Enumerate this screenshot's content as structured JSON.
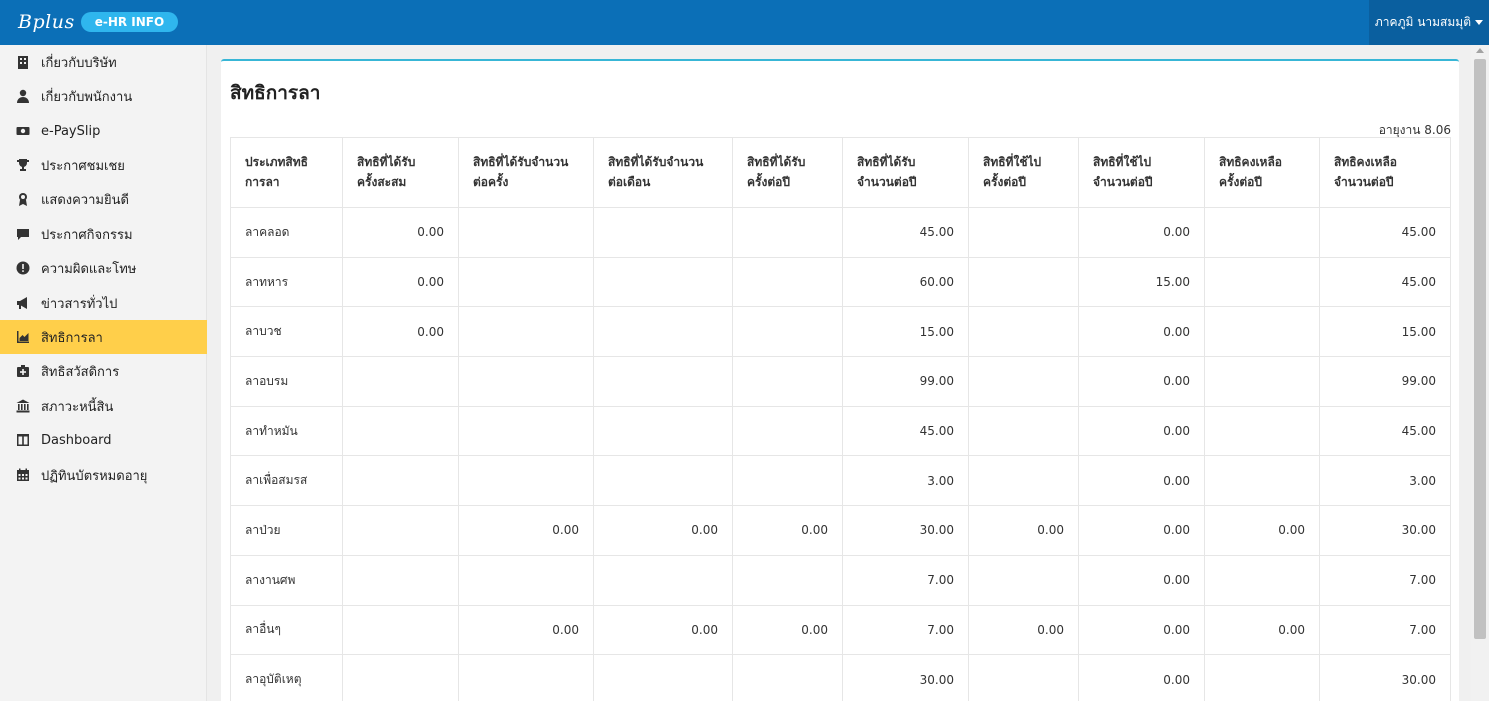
{
  "header": {
    "logo_text": "Bplus",
    "app_badge": "e-HR INFO",
    "user_name": "ภาคภูมิ นามสมมุติ"
  },
  "sidebar": {
    "items": [
      {
        "label": "เกี่ยวกับบริษัท",
        "icon": "building-icon",
        "active": false
      },
      {
        "label": "เกี่ยวกับพนักงาน",
        "icon": "user-icon",
        "active": false
      },
      {
        "label": "e-PaySlip",
        "icon": "money-icon",
        "active": false
      },
      {
        "label": "ประกาศชมเชย",
        "icon": "trophy-icon",
        "active": false
      },
      {
        "label": "แสดงความยินดี",
        "icon": "award-icon",
        "active": false
      },
      {
        "label": "ประกาศกิจกรรม",
        "icon": "comment-icon",
        "active": false
      },
      {
        "label": "ความผิดและโทษ",
        "icon": "exclamation-icon",
        "active": false
      },
      {
        "label": "ข่าวสารทั่วไป",
        "icon": "megaphone-icon",
        "active": false
      },
      {
        "label": "สิทธิการลา",
        "icon": "chart-area-icon",
        "active": true
      },
      {
        "label": "สิทธิสวัสดิการ",
        "icon": "medkit-icon",
        "active": false
      },
      {
        "label": "สภาวะหนี้สิน",
        "icon": "bank-icon",
        "active": false
      },
      {
        "label": "Dashboard",
        "icon": "columns-icon",
        "active": false
      },
      {
        "label": "ปฏิทินบัตรหมดอายุ",
        "icon": "calendar-icon",
        "active": false
      }
    ]
  },
  "page": {
    "title": "สิทธิการลา",
    "age_label": "อายุงาน 8.06"
  },
  "table": {
    "headers": [
      [
        "ประเภทสิทธิ",
        "การลา"
      ],
      [
        "สิทธิที่ได้รับ",
        "ครั้งสะสม"
      ],
      [
        "สิทธิที่ได้รับจำนวน",
        "ต่อครั้ง"
      ],
      [
        "สิทธิที่ได้รับจำนวน",
        "ต่อเดือน"
      ],
      [
        "สิทธิที่ได้รับ",
        "ครั้งต่อปี"
      ],
      [
        "สิทธิที่ได้รับ",
        "จำนวนต่อปี"
      ],
      [
        "สิทธิที่ใช้ไป",
        "ครั้งต่อปี"
      ],
      [
        "สิทธิที่ใช้ไป",
        "จำนวนต่อปี"
      ],
      [
        "สิทธิคงเหลือ",
        "ครั้งต่อปี"
      ],
      [
        "สิทธิคงเหลือ",
        "จำนวนต่อปี"
      ]
    ],
    "rows": [
      [
        "ลาคลอด",
        "0.00",
        "",
        "",
        "",
        "45.00",
        "",
        "0.00",
        "",
        "45.00"
      ],
      [
        "ลาทหาร",
        "0.00",
        "",
        "",
        "",
        "60.00",
        "",
        "15.00",
        "",
        "45.00"
      ],
      [
        "ลาบวช",
        "0.00",
        "",
        "",
        "",
        "15.00",
        "",
        "0.00",
        "",
        "15.00"
      ],
      [
        "ลาอบรม",
        "",
        "",
        "",
        "",
        "99.00",
        "",
        "0.00",
        "",
        "99.00"
      ],
      [
        "ลาทำหมัน",
        "",
        "",
        "",
        "",
        "45.00",
        "",
        "0.00",
        "",
        "45.00"
      ],
      [
        "ลาเพื่อสมรส",
        "",
        "",
        "",
        "",
        "3.00",
        "",
        "0.00",
        "",
        "3.00"
      ],
      [
        "ลาป่วย",
        "",
        "0.00",
        "0.00",
        "0.00",
        "30.00",
        "0.00",
        "0.00",
        "0.00",
        "30.00"
      ],
      [
        "ลางานศพ",
        "",
        "",
        "",
        "",
        "7.00",
        "",
        "0.00",
        "",
        "7.00"
      ],
      [
        "ลาอื่นๆ",
        "",
        "0.00",
        "0.00",
        "0.00",
        "7.00",
        "0.00",
        "0.00",
        "0.00",
        "7.00"
      ],
      [
        "ลาอุบัติเหตุ",
        "",
        "",
        "",
        "",
        "30.00",
        "",
        "0.00",
        "",
        "30.00"
      ]
    ]
  },
  "colors": {
    "topbar": "#0b6fb7",
    "badge": "#2fb6ee",
    "active_item": "#ffcf4a",
    "card_accent": "#38b6d6"
  }
}
